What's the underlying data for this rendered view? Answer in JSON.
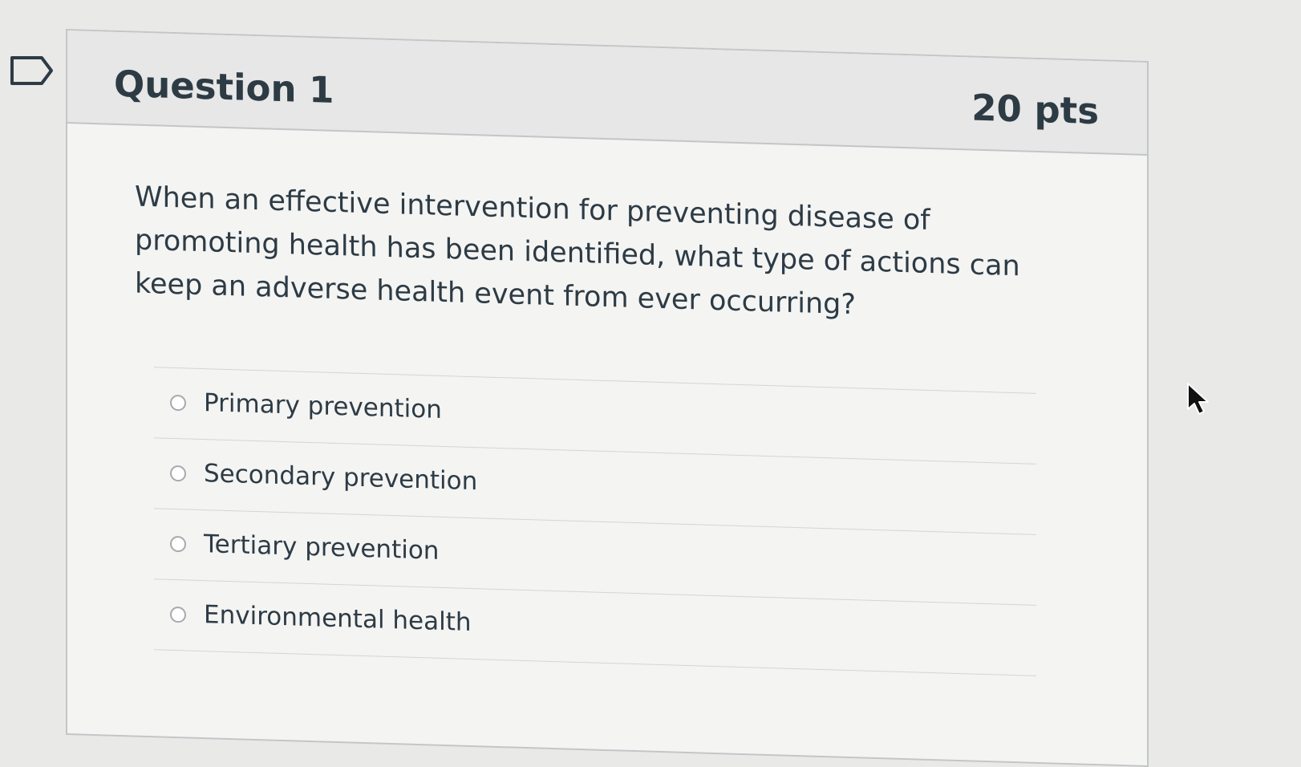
{
  "question": {
    "title": "Question 1",
    "points": "20 pts",
    "text": "When an effective intervention for preventing disease of promoting health has been identified, what type of actions can keep an adverse health event from ever occurring?"
  },
  "answers": [
    {
      "label": "Primary prevention",
      "selected": false
    },
    {
      "label": "Secondary prevention",
      "selected": false
    },
    {
      "label": "Tertiary prevention",
      "selected": false
    },
    {
      "label": "Environmental health",
      "selected": false
    }
  ],
  "icons": {
    "flag": "flag-icon",
    "cursor": "mouse-pointer-icon"
  },
  "colors": {
    "text": "#2d3b45",
    "header_background": "#e6e7e6",
    "border": "#c3c6c8",
    "page_background": "#e9e9e7"
  }
}
